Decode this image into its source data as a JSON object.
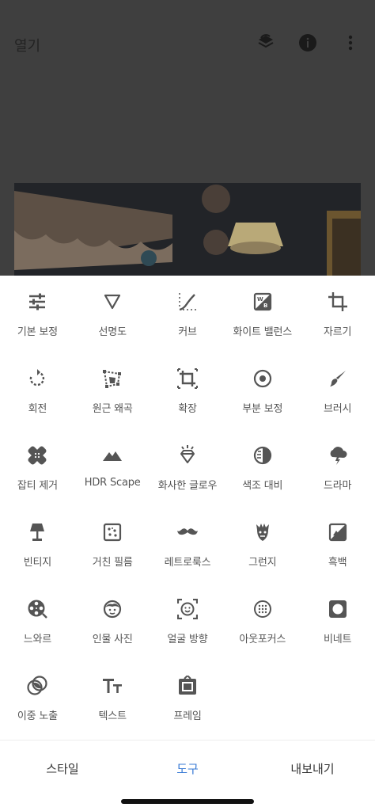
{
  "header": {
    "title": "열기",
    "icons": [
      "layers-undo-icon",
      "info-icon",
      "more-vert-icon"
    ]
  },
  "tools": [
    {
      "label": "기본 보정",
      "icon": "tune-icon"
    },
    {
      "label": "선명도",
      "icon": "triangle-icon"
    },
    {
      "label": "커브",
      "icon": "curve-icon"
    },
    {
      "label": "화이트 밸런스",
      "icon": "white-balance-icon"
    },
    {
      "label": "자르기",
      "icon": "crop-icon"
    },
    {
      "label": "회전",
      "icon": "rotate-icon"
    },
    {
      "label": "원근 왜곡",
      "icon": "perspective-icon"
    },
    {
      "label": "확장",
      "icon": "expand-icon"
    },
    {
      "label": "부분 보정",
      "icon": "selective-icon"
    },
    {
      "label": "브러시",
      "icon": "brush-icon"
    },
    {
      "label": "잡티 제거",
      "icon": "healing-icon"
    },
    {
      "label": "HDR Scape",
      "icon": "mountain-icon"
    },
    {
      "label": "화사한 글로우",
      "icon": "glamour-glow-icon"
    },
    {
      "label": "색조 대비",
      "icon": "tonal-contrast-icon"
    },
    {
      "label": "드라마",
      "icon": "drama-cloud-icon"
    },
    {
      "label": "빈티지",
      "icon": "lamp-icon"
    },
    {
      "label": "거친 필름",
      "icon": "grainy-film-icon"
    },
    {
      "label": "레트로룩스",
      "icon": "mustache-icon"
    },
    {
      "label": "그런지",
      "icon": "grunge-icon"
    },
    {
      "label": "흑백",
      "icon": "black-white-icon"
    },
    {
      "label": "느와르",
      "icon": "film-reel-icon"
    },
    {
      "label": "인물 사진",
      "icon": "portrait-face-icon"
    },
    {
      "label": "얼굴 방향",
      "icon": "head-pose-icon"
    },
    {
      "label": "아웃포커스",
      "icon": "lens-blur-icon"
    },
    {
      "label": "비네트",
      "icon": "vignette-icon"
    },
    {
      "label": "이중 노출",
      "icon": "double-exposure-icon"
    },
    {
      "label": "텍스트",
      "icon": "text-icon"
    },
    {
      "label": "프레임",
      "icon": "frame-icon"
    }
  ],
  "tabs": {
    "styles": "스타일",
    "tools": "도구",
    "export": "내보내기",
    "active": "tools"
  },
  "colors": {
    "accent": "#3a7bd5",
    "icon": "#555555",
    "overlay": "#3f3f3f"
  }
}
